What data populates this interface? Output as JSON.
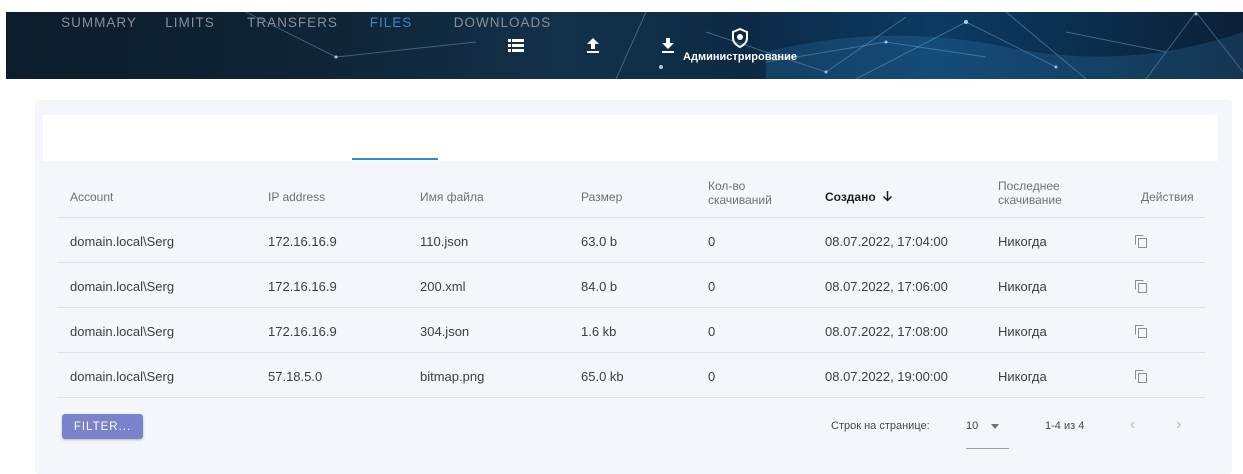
{
  "header": {
    "nav": [
      {
        "name": "list-icon",
        "label": ""
      },
      {
        "name": "upload-icon",
        "label": ""
      },
      {
        "name": "download-icon",
        "label": ""
      },
      {
        "name": "admin-shield-icon",
        "label": "Администрирование"
      }
    ]
  },
  "tabs": [
    {
      "label": "SUMMARY",
      "active": false
    },
    {
      "label": "LIMITS",
      "active": false
    },
    {
      "label": "TRANSFERS",
      "active": false
    },
    {
      "label": "FILES",
      "active": true
    },
    {
      "label": "DOWNLOADS",
      "active": false
    }
  ],
  "table": {
    "columns": [
      "Account",
      "IP address",
      "Имя файла",
      "Размер",
      "Кол-во скачиваний",
      "Создано",
      "Последнее скачивание",
      "Действия"
    ],
    "sorted_column": "Создано",
    "sort_direction": "descending",
    "rows": [
      [
        "domain.local\\Serg",
        "172.16.16.9",
        "110.json",
        "63.0 b",
        "0",
        "08.07.2022, 17:04:00",
        "Никогда"
      ],
      [
        "domain.local\\Serg",
        "172.16.16.9",
        "200.xml",
        "84.0 b",
        "0",
        "08.07.2022, 17:06:00",
        "Никогда"
      ],
      [
        "domain.local\\Serg",
        "172.16.16.9",
        "304.json",
        "1.6 kb",
        "0",
        "08.07.2022, 17:08:00",
        "Никогда"
      ],
      [
        "domain.local\\Serg",
        "57.18.5.0",
        "bitmap.png",
        "65.0 kb",
        "0",
        "08.07.2022, 19:00:00",
        "Никогда"
      ]
    ],
    "row_action_icon": "copy-icon"
  },
  "footer": {
    "filter_label": "FILTER...",
    "rows_per_page_label": "Строк на странице:",
    "rows_per_page_value": "10",
    "range_label": "1-4 из 4",
    "prev_icon": "chevron-left-icon",
    "next_icon": "chevron-right-icon"
  },
  "colors": {
    "accent": "#3a87c9",
    "filter_button": "#7b82cc",
    "card_background": "#f3f6fa"
  }
}
